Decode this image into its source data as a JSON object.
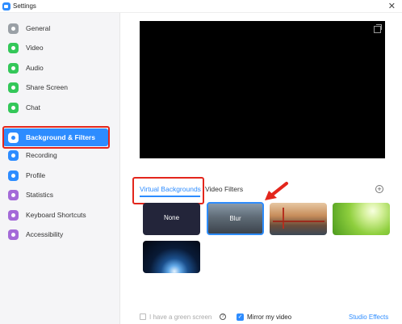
{
  "window": {
    "title": "Settings",
    "close_glyph": "✕"
  },
  "sidebar": {
    "items": [
      {
        "label": "General",
        "icon": "gear-icon",
        "color": "#9aa0a6"
      },
      {
        "label": "Video",
        "icon": "video-icon",
        "color": "#34c759"
      },
      {
        "label": "Audio",
        "icon": "headphones-icon",
        "color": "#34c759"
      },
      {
        "label": "Share Screen",
        "icon": "share-screen-icon",
        "color": "#34c759"
      },
      {
        "label": "Chat",
        "icon": "chat-icon",
        "color": "#34c759"
      },
      {
        "label": "Background & Filters",
        "icon": "person-background-icon",
        "color": "#2d8cff",
        "active": true
      },
      {
        "label": "Recording",
        "icon": "record-icon",
        "color": "#2d8cff"
      },
      {
        "label": "Profile",
        "icon": "profile-icon",
        "color": "#2d8cff"
      },
      {
        "label": "Statistics",
        "icon": "statistics-icon",
        "color": "#a46ad8"
      },
      {
        "label": "Keyboard Shortcuts",
        "icon": "keyboard-icon",
        "color": "#a46ad8"
      },
      {
        "label": "Accessibility",
        "icon": "accessibility-icon",
        "color": "#a46ad8"
      }
    ]
  },
  "tabs": {
    "virtual": "Virtual Backgrounds",
    "filters": "Video Filters"
  },
  "backgrounds": {
    "none": "None",
    "blur": "Blur",
    "selected": "Blur"
  },
  "footer": {
    "green_screen_label": "I have a green screen",
    "green_screen_checked": false,
    "help_glyph": "?",
    "mirror_label": "Mirror my video",
    "mirror_checked": true,
    "checkmark": "✓",
    "studio_effects": "Studio Effects"
  },
  "add_glyph": "+",
  "colors": {
    "accent": "#2d8cff",
    "highlight_red": "#e3261c"
  }
}
